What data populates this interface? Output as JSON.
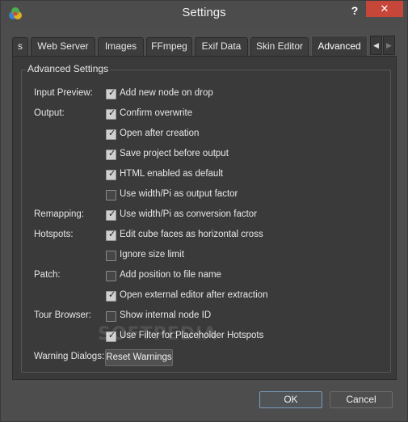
{
  "window": {
    "title": "Settings",
    "help_label": "?",
    "close_label": "✕"
  },
  "tabs": [
    {
      "label": "s"
    },
    {
      "label": "Web Server"
    },
    {
      "label": "Images"
    },
    {
      "label": "FFmpeg"
    },
    {
      "label": "Exif Data"
    },
    {
      "label": "Skin Editor"
    },
    {
      "label": "Advanced",
      "active": true
    }
  ],
  "tab_scroll": {
    "left": "◀",
    "right": "▶"
  },
  "group": {
    "title": "Advanced Settings"
  },
  "labels": {
    "input_preview": "Input Preview:",
    "output": "Output:",
    "remapping": "Remapping:",
    "hotspots": "Hotspots:",
    "patch": "Patch:",
    "tour_browser": "Tour Browser:",
    "warning_dialogs": "Warning Dialogs:"
  },
  "options": [
    {
      "label": "Add new node on drop",
      "checked": true
    },
    {
      "label": "Confirm overwrite",
      "checked": true
    },
    {
      "label": "Open after creation",
      "checked": true
    },
    {
      "label": "Save project before output",
      "checked": true
    },
    {
      "label": "HTML enabled as default",
      "checked": true
    },
    {
      "label": "Use width/Pi as output factor",
      "checked": false
    },
    {
      "label": "Use width/Pi as conversion factor",
      "checked": true
    },
    {
      "label": "Edit cube faces as horizontal cross",
      "checked": true
    },
    {
      "label": "Ignore size limit",
      "checked": false
    },
    {
      "label": "Add position to file name",
      "checked": false
    },
    {
      "label": "Open external editor after extraction",
      "checked": true
    },
    {
      "label": "Show internal node ID",
      "checked": false
    },
    {
      "label": "Use Filter for Placeholder Hotspots",
      "checked": true
    }
  ],
  "reset_warnings_label": "Reset Warnings",
  "watermark": "SOFTPEDIA",
  "buttons": {
    "ok": "OK",
    "cancel": "Cancel"
  },
  "colors": {
    "close": "#c7463a",
    "panel": "#3a3a3a",
    "window": "#4d4d4d"
  }
}
